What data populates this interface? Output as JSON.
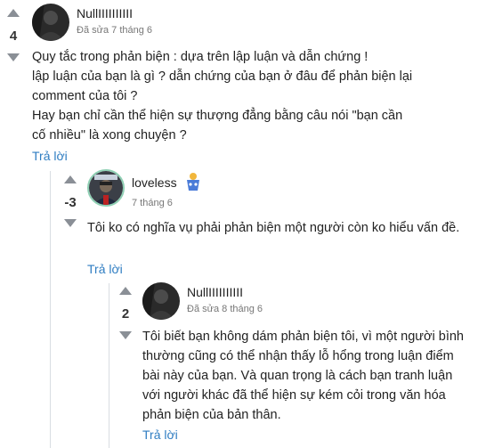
{
  "comments": [
    {
      "author": "NullIIIIIIIIII",
      "score": "4",
      "meta": "Đã sửa 7 tháng 6",
      "body": "Quy tắc trong phản biện : dựa trên lập luận và dẫn chứng !\nlập luận của bạn là gì ? dẫn chứng của bạn ở đâu để phản biện lại comment của tôi ?\nHay bạn chỉ cần thể hiện sự thượng đẳng bằng câu nói \"bạn cần cố nhiều\" là xong chuyện ?",
      "reply_label": "Trả lời"
    },
    {
      "author": "loveless",
      "score": "-3",
      "meta": "7 tháng 6",
      "body": "Tôi ko có nghĩa vụ phải phản biện một người còn ko hiểu vấn đề.",
      "reply_label": "Trả lời"
    },
    {
      "author": "NullIIIIIIIIII",
      "score": "2",
      "meta": "Đã sửa 8 tháng 6",
      "body": "Tôi biết bạn không dám phản biện tôi, vì một người bình thường cũng có thể nhận thấy lỗ hổng trong luận điểm bài này của bạn. Và quan trọng là cách bạn tranh luận với người khác đã thể hiện sự kém cỏi trong văn hóa phản biện của bản thân.",
      "reply_label": "Trả lời"
    }
  ]
}
